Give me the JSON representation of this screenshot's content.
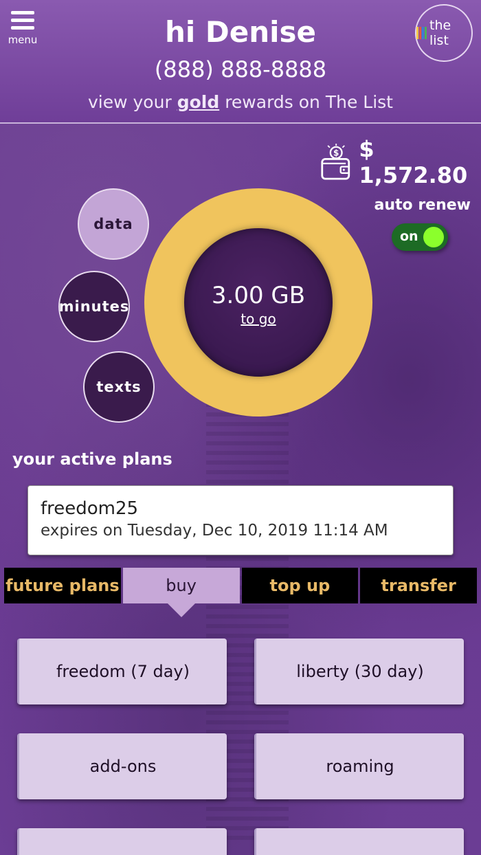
{
  "header": {
    "menu_label": "menu",
    "greeting": "hi Denise",
    "phone": "(888) 888-8888",
    "rewards_prefix": "view your",
    "rewards_tier": "gold",
    "rewards_suffix": "rewards on The List",
    "thelist_label": "the list",
    "thelist_bar_colors": [
      "#f4c84b",
      "#e05a3a",
      "#3b7fd6",
      "#4cb05a"
    ]
  },
  "balance": {
    "amount": "$ 1,572.80",
    "icon": "wallet-dollar-icon"
  },
  "auto_renew": {
    "label": "auto renew",
    "state": "on",
    "enabled": true
  },
  "usage": {
    "selectors": [
      {
        "label": "data",
        "selected": true
      },
      {
        "label": "minutes",
        "selected": false
      },
      {
        "label": "texts",
        "selected": false
      }
    ],
    "remaining_value": "3.00 GB",
    "remaining_label": "to go",
    "ring_color": "#f0c45d"
  },
  "active_plans": {
    "title": "your active plans",
    "items": [
      {
        "name": "freedom25",
        "expiry": "expires on Tuesday, Dec 10, 2019 11:14 AM"
      }
    ]
  },
  "tabs": [
    {
      "label": "future plans",
      "active": false
    },
    {
      "label": "buy",
      "active": true
    },
    {
      "label": "top up",
      "active": false
    },
    {
      "label": "transfer",
      "active": false
    }
  ],
  "buy_options": [
    {
      "label": "freedom (7 day)"
    },
    {
      "label": "liberty (30 day)"
    },
    {
      "label": "add-ons"
    },
    {
      "label": "roaming"
    },
    {
      "label": ""
    },
    {
      "label": ""
    }
  ],
  "colors": {
    "primary_purple": "#6e3f96",
    "accent_gold": "#e8b967",
    "toggle_green": "#1d6b25",
    "toggle_knob": "#8bff2c"
  }
}
